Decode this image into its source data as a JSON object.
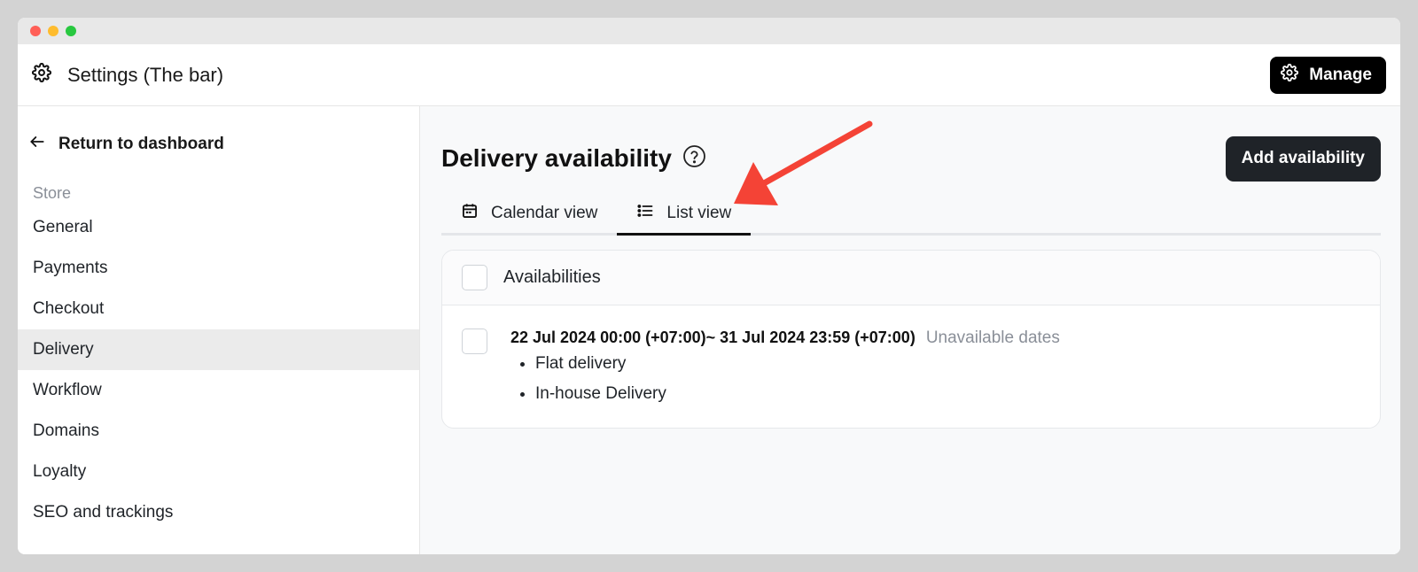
{
  "header": {
    "title": "Settings (The bar)",
    "manage_label": "Manage"
  },
  "sidebar": {
    "return_label": "Return to dashboard",
    "section_label": "Store",
    "items": [
      {
        "label": "General"
      },
      {
        "label": "Payments"
      },
      {
        "label": "Checkout"
      },
      {
        "label": "Delivery"
      },
      {
        "label": "Workflow"
      },
      {
        "label": "Domains"
      },
      {
        "label": "Loyalty"
      },
      {
        "label": "SEO and trackings"
      }
    ],
    "active_item": "Delivery"
  },
  "main": {
    "title": "Delivery availability",
    "add_button_label": "Add availability",
    "tabs": [
      {
        "label": "Calendar view",
        "icon": "calendar-icon"
      },
      {
        "label": "List view",
        "icon": "list-icon"
      }
    ],
    "active_tab": "List view",
    "list": {
      "header_label": "Availabilities",
      "rows": [
        {
          "date_range": "22 Jul 2024 00:00 (+07:00)~ 31 Jul 2024 23:59 (+07:00)",
          "status": "Unavailable dates",
          "methods": [
            "Flat delivery",
            "In-house Delivery"
          ]
        }
      ]
    }
  },
  "colors": {
    "annotation_arrow": "#f44336",
    "primary_button": "#1f2328",
    "active_nav_bg": "#ebebeb"
  }
}
